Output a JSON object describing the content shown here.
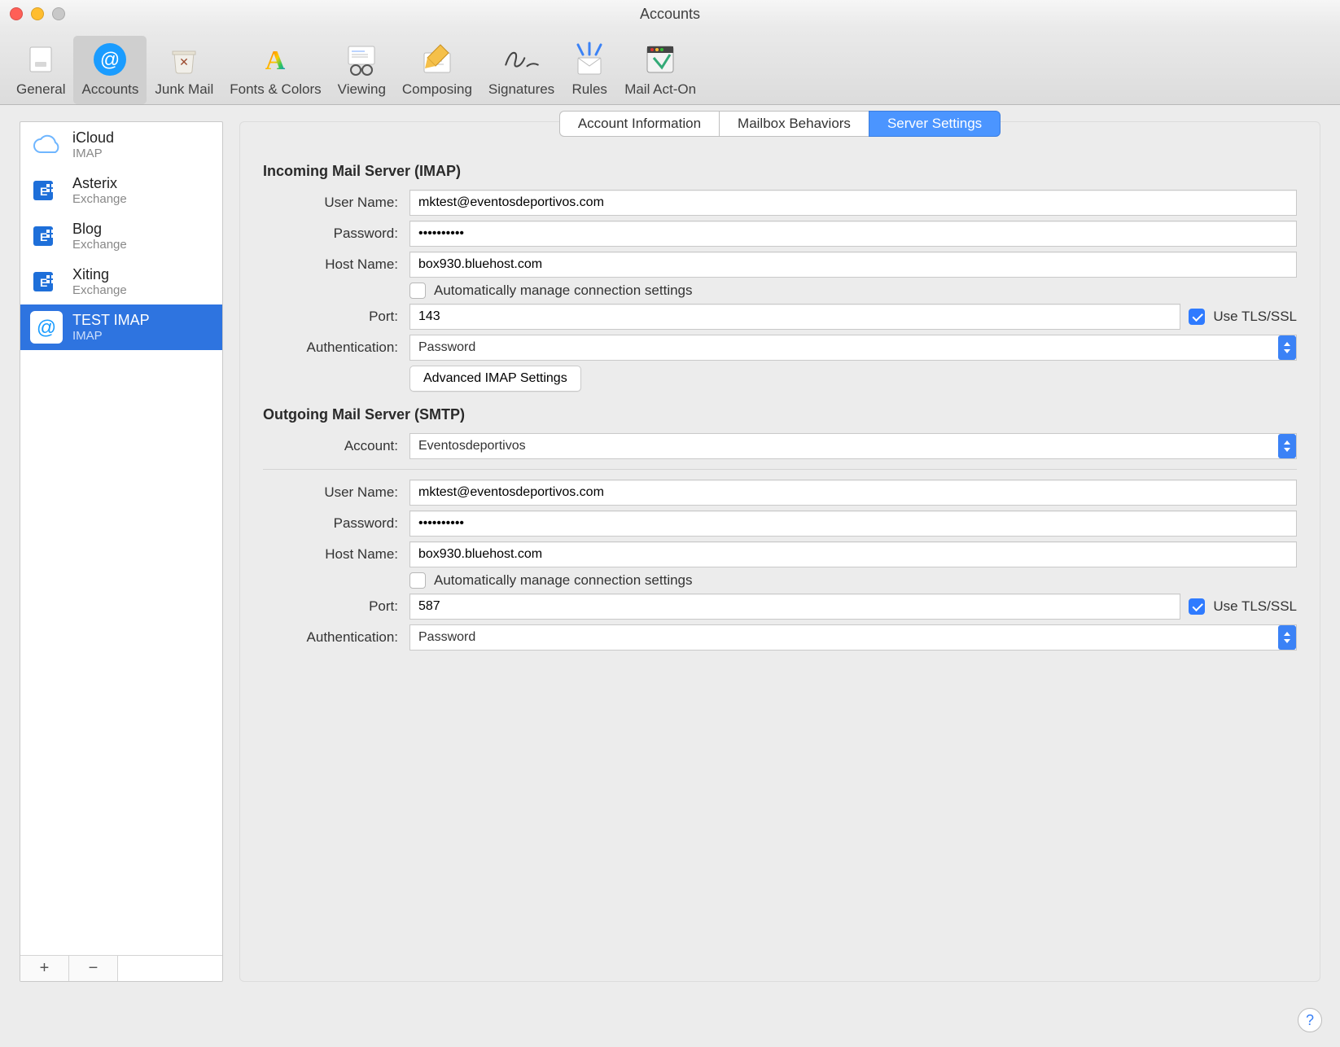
{
  "window": {
    "title": "Accounts"
  },
  "toolbar": {
    "items": [
      {
        "label": "General"
      },
      {
        "label": "Accounts"
      },
      {
        "label": "Junk Mail"
      },
      {
        "label": "Fonts & Colors"
      },
      {
        "label": "Viewing"
      },
      {
        "label": "Composing"
      },
      {
        "label": "Signatures"
      },
      {
        "label": "Rules"
      },
      {
        "label": "Mail Act-On"
      }
    ],
    "active_index": 1
  },
  "sidebar": {
    "accounts": [
      {
        "name": "iCloud",
        "sub": "IMAP",
        "icon": "cloud"
      },
      {
        "name": "Asterix",
        "sub": "Exchange",
        "icon": "exchange"
      },
      {
        "name": "Blog",
        "sub": "Exchange",
        "icon": "exchange"
      },
      {
        "name": "Xiting",
        "sub": "Exchange",
        "icon": "exchange"
      },
      {
        "name": "TEST IMAP",
        "sub": "IMAP",
        "icon": "at"
      }
    ],
    "selected_index": 4,
    "footer": {
      "add": "+",
      "remove": "−"
    }
  },
  "tabs": {
    "items": [
      "Account Information",
      "Mailbox Behaviors",
      "Server Settings"
    ],
    "active_index": 2
  },
  "labels": {
    "user_name": "User Name:",
    "password": "Password:",
    "host_name": "Host Name:",
    "port": "Port:",
    "authentication": "Authentication:",
    "account": "Account:",
    "auto_manage": "Automatically manage connection settings",
    "use_tls": "Use TLS/SSL",
    "advanced_imap": "Advanced IMAP Settings"
  },
  "incoming": {
    "heading": "Incoming Mail Server (IMAP)",
    "user_name": "mktest@eventosdeportivos.com",
    "password": "••••••••••",
    "host_name": "box930.bluehost.com",
    "auto_manage": false,
    "port": "143",
    "use_tls": true,
    "authentication": "Password"
  },
  "outgoing": {
    "heading": "Outgoing Mail Server (SMTP)",
    "account": "Eventosdeportivos",
    "user_name": "mktest@eventosdeportivos.com",
    "password": "••••••••••",
    "host_name": "box930.bluehost.com",
    "auto_manage": false,
    "port": "587",
    "use_tls": true,
    "authentication": "Password"
  },
  "help": "?"
}
